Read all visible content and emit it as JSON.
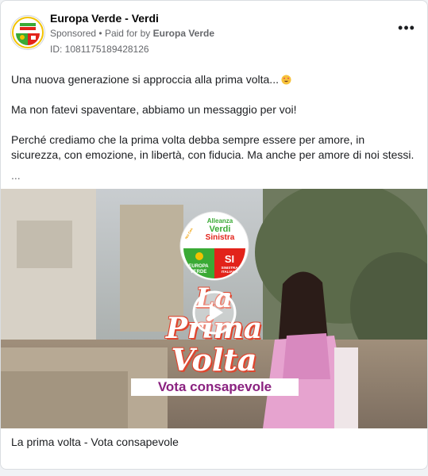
{
  "post": {
    "page_name": "Europa Verde - Verdi",
    "sponsored": "Sponsored",
    "separator": "•",
    "paid_for_prefix": "Paid for by",
    "paid_for_by": "Europa Verde",
    "ad_id": "ID: 1081175189428126",
    "more_icon": "more-horizontal-icon",
    "more_label": "•••",
    "text": {
      "line1": "Una nuova generazione si approccia alla prima volta...",
      "line1_emoji": "smiling-face-with-heart-eyes-emoji",
      "line2": "Ma non fatevi spaventare, abbiamo un messaggio per voi!",
      "line3": "Perché crediamo che la prima volta debba sempre essere per amore, in sicurezza, con emozione, in libertà, con fiducia. Ma anche per amore di noi stessi.",
      "see_more": "..."
    }
  },
  "media": {
    "logo": {
      "top": "Alleanza",
      "middle": "Verdi",
      "bottom": "Sinistra",
      "tag": "Noi Con",
      "left_party_line1": "EUROPA",
      "left_party_line2": "VERDE",
      "right_party_mark": "SI",
      "right_party_line1": "SINISTRA",
      "right_party_line2": "ITALIANA"
    },
    "title_line1": "La",
    "title_line2": "Prima",
    "title_line3": "Volta",
    "tagline": "Vota consapevole",
    "play_icon": "play-icon"
  },
  "caption": {
    "title": "La prima volta - Vota consapevole"
  },
  "colors": {
    "background": "#f0f2f5",
    "card": "#ffffff",
    "secondary_text": "#65676b",
    "logo_green": "#3aaa35",
    "logo_red": "#e2231a",
    "tagline_purple": "#8a2280",
    "title_outline": "#e0452e"
  }
}
